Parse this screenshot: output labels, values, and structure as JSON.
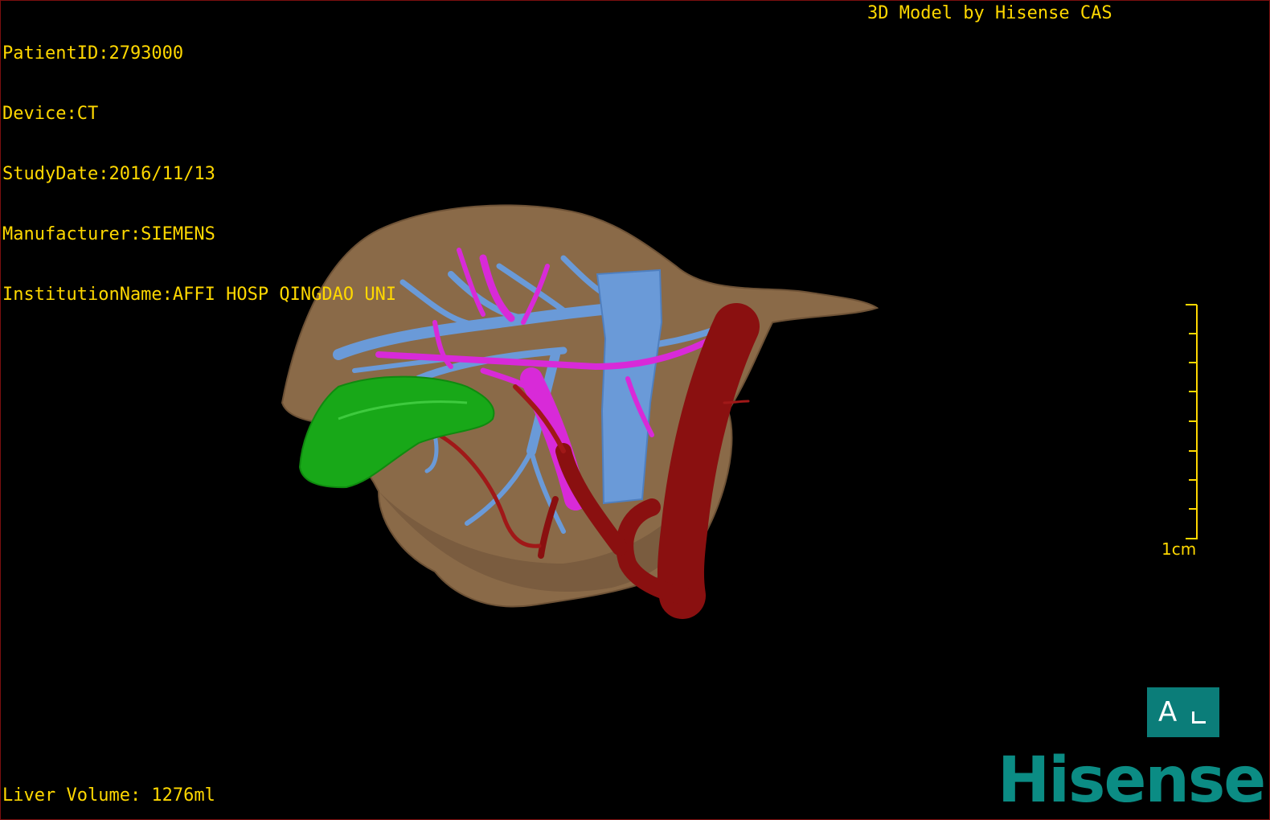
{
  "header": {
    "patient_id": "PatientID:2793000",
    "device": "Device:CT",
    "study_date": "StudyDate:2016/11/13",
    "manufacturer": "Manufacturer:SIEMENS",
    "institution": "InstitutionName:AFFI HOSP QINGDAO UNI",
    "credit": "3D Model by Hisense CAS"
  },
  "footer": {
    "liver_volume": "Liver Volume: 1276ml"
  },
  "scale": {
    "label": "1cm"
  },
  "orientation": {
    "letter": "A"
  },
  "brand": {
    "name": "Hisense"
  },
  "colors": {
    "overlay_text": "#ffd800",
    "liver": "#8a6a48",
    "portal_vein": "#6a9ad8",
    "hepatic_vein": "#d82ad8",
    "artery": "#8a1010",
    "gallbladder": "#18a818",
    "brand": "#0b8c84"
  }
}
